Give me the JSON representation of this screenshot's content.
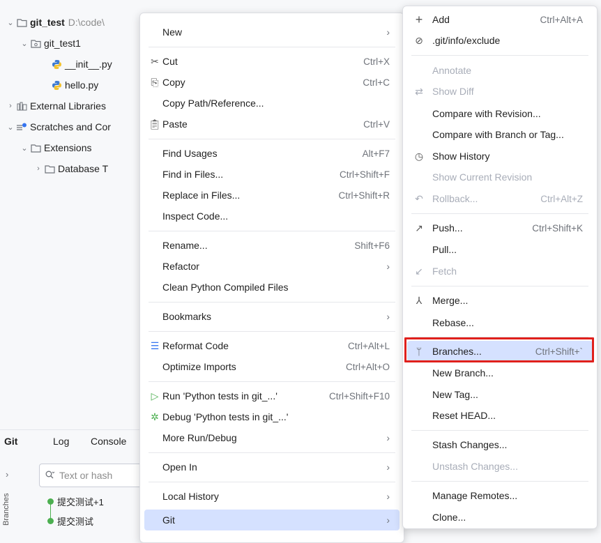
{
  "project": {
    "root_name": "git_test",
    "root_path": "D:\\code\\",
    "module": "git_test1",
    "files": [
      "__init__.py",
      "hello.py"
    ],
    "external_libraries": "External Libraries",
    "scratches": "Scratches and Cor",
    "extensions": "Extensions",
    "database": "Database T"
  },
  "git_panel": {
    "tabs": [
      "Git",
      "Log",
      "Console"
    ],
    "search_placeholder": "Text or hash",
    "branches_label": "Branches",
    "commits": [
      "提交测试+1",
      "提交测试"
    ]
  },
  "context_menu": {
    "items": [
      {
        "label": "New",
        "shortcut": "",
        "submenu": true,
        "icon": ""
      },
      {
        "label": "Cut",
        "shortcut": "Ctrl+X",
        "icon": "scissors-icon"
      },
      {
        "label": "Copy",
        "shortcut": "Ctrl+C",
        "icon": "copy-icon"
      },
      {
        "label": "Copy Path/Reference...",
        "shortcut": ""
      },
      {
        "label": "Paste",
        "shortcut": "Ctrl+V",
        "icon": "paste-icon"
      },
      {
        "label": "Find Usages",
        "shortcut": "Alt+F7"
      },
      {
        "label": "Find in Files...",
        "shortcut": "Ctrl+Shift+F"
      },
      {
        "label": "Replace in Files...",
        "shortcut": "Ctrl+Shift+R"
      },
      {
        "label": "Inspect Code...",
        "shortcut": ""
      },
      {
        "label": "Rename...",
        "shortcut": "Shift+F6"
      },
      {
        "label": "Refactor",
        "shortcut": "",
        "submenu": true
      },
      {
        "label": "Clean Python Compiled Files",
        "shortcut": ""
      },
      {
        "label": "Bookmarks",
        "shortcut": "",
        "submenu": true
      },
      {
        "label": "Reformat Code",
        "shortcut": "Ctrl+Alt+L",
        "icon": "reformat-icon"
      },
      {
        "label": "Optimize Imports",
        "shortcut": "Ctrl+Alt+O"
      },
      {
        "label": "Run 'Python tests in git_...'",
        "shortcut": "Ctrl+Shift+F10",
        "icon": "run-icon"
      },
      {
        "label": "Debug 'Python tests in git_...'",
        "shortcut": "",
        "icon": "debug-icon"
      },
      {
        "label": "More Run/Debug",
        "shortcut": "",
        "submenu": true
      },
      {
        "label": "Open In",
        "shortcut": "",
        "submenu": true
      },
      {
        "label": "Local History",
        "shortcut": "",
        "submenu": true
      },
      {
        "label": "Git",
        "shortcut": "",
        "submenu": true
      }
    ]
  },
  "git_menu": {
    "items": [
      {
        "label": "Add",
        "shortcut": "Ctrl+Alt+A",
        "icon": "plus-icon"
      },
      {
        "label": ".git/info/exclude",
        "shortcut": "",
        "icon": "ban-icon"
      },
      {
        "label": "Annotate",
        "shortcut": "",
        "disabled": true
      },
      {
        "label": "Show Diff",
        "shortcut": "",
        "disabled": true,
        "icon": "diff-icon"
      },
      {
        "label": "Compare with Revision...",
        "shortcut": ""
      },
      {
        "label": "Compare with Branch or Tag...",
        "shortcut": ""
      },
      {
        "label": "Show History",
        "shortcut": "",
        "icon": "clock-icon"
      },
      {
        "label": "Show Current Revision",
        "shortcut": "",
        "disabled": true
      },
      {
        "label": "Rollback...",
        "shortcut": "Ctrl+Alt+Z",
        "disabled": true,
        "icon": "rollback-icon"
      },
      {
        "label": "Push...",
        "shortcut": "Ctrl+Shift+K",
        "icon": "push-icon"
      },
      {
        "label": "Pull...",
        "shortcut": ""
      },
      {
        "label": "Fetch",
        "shortcut": "",
        "disabled": true,
        "icon": "fetch-icon"
      },
      {
        "label": "Merge...",
        "shortcut": "",
        "icon": "merge-icon"
      },
      {
        "label": "Rebase...",
        "shortcut": ""
      },
      {
        "label": "Branches...",
        "shortcut": "Ctrl+Shift+`",
        "icon": "branch-icon",
        "selected": true
      },
      {
        "label": "New Branch...",
        "shortcut": ""
      },
      {
        "label": "New Tag...",
        "shortcut": ""
      },
      {
        "label": "Reset HEAD...",
        "shortcut": ""
      },
      {
        "label": "Stash Changes...",
        "shortcut": ""
      },
      {
        "label": "Unstash Changes...",
        "shortcut": "",
        "disabled": true
      },
      {
        "label": "Manage Remotes...",
        "shortcut": ""
      },
      {
        "label": "Clone...",
        "shortcut": ""
      }
    ]
  }
}
